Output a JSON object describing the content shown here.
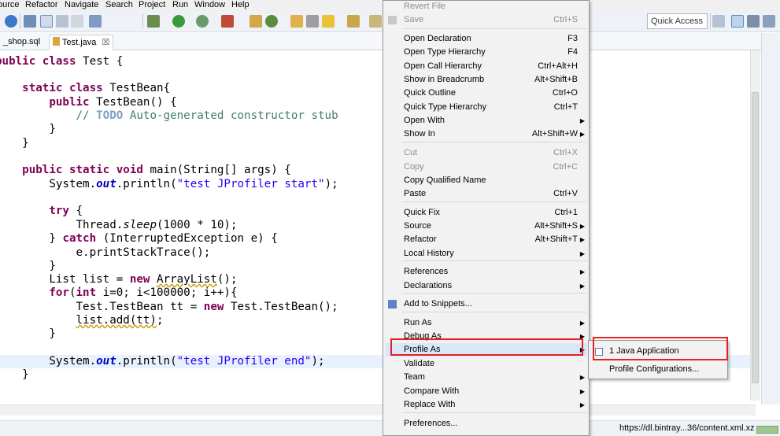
{
  "menubar": {
    "items": [
      "ource",
      "Refactor",
      "Navigate",
      "Search",
      "Project",
      "Run",
      "Window",
      "Help"
    ]
  },
  "toolbar": {
    "quick_access_placeholder": "Quick Access",
    "icons": [
      "help-icon",
      "new-icon",
      "select-icon",
      "cursor-icon",
      "text-icon",
      "debug-icon",
      "run-icon",
      "stop-icon",
      "profile-icon",
      "build-icon",
      "search-icon",
      "back-icon",
      "forward-icon",
      "perspective-icon"
    ]
  },
  "tabs": [
    {
      "label": "_shop.sql"
    },
    {
      "label": "Test.java",
      "close": "☒"
    }
  ],
  "editor": {
    "lines": [
      {
        "indent": "",
        "tokens": [
          {
            "t": "public class",
            "c": "kw"
          },
          {
            "t": " Test {"
          }
        ]
      },
      {
        "indent": "",
        "tokens": []
      },
      {
        "indent": "    ",
        "tokens": [
          {
            "t": "static class",
            "c": "kw"
          },
          {
            "t": " TestBean{"
          }
        ]
      },
      {
        "indent": "        ",
        "tokens": [
          {
            "t": "public",
            "c": "kw"
          },
          {
            "t": " TestBean() {"
          }
        ]
      },
      {
        "indent": "            ",
        "tokens": [
          {
            "t": "// ",
            "c": "cm"
          },
          {
            "t": "TODO",
            "c": "todo"
          },
          {
            "t": " Auto-generated constructor stub",
            "c": "cm"
          }
        ]
      },
      {
        "indent": "        ",
        "tokens": [
          {
            "t": "}"
          }
        ]
      },
      {
        "indent": "    ",
        "tokens": [
          {
            "t": "}"
          }
        ]
      },
      {
        "indent": "",
        "tokens": []
      },
      {
        "indent": "    ",
        "tokens": [
          {
            "t": "public static void",
            "c": "kw"
          },
          {
            "t": " main(String[] args) {"
          }
        ]
      },
      {
        "indent": "        ",
        "tokens": [
          {
            "t": "System."
          },
          {
            "t": "out",
            "c": "fld"
          },
          {
            "t": ".println("
          },
          {
            "t": "\"test JProfiler start\"",
            "c": "str"
          },
          {
            "t": ");"
          }
        ]
      },
      {
        "indent": "",
        "tokens": []
      },
      {
        "indent": "        ",
        "tokens": [
          {
            "t": "try",
            "c": "kw"
          },
          {
            "t": " {"
          }
        ]
      },
      {
        "indent": "            ",
        "tokens": [
          {
            "t": "Thread."
          },
          {
            "t": "sleep",
            "c": "ital"
          },
          {
            "t": "(1000 * 10);"
          }
        ]
      },
      {
        "indent": "        ",
        "tokens": [
          {
            "t": "} "
          },
          {
            "t": "catch",
            "c": "kw"
          },
          {
            "t": " (InterruptedException e) {"
          }
        ]
      },
      {
        "indent": "            ",
        "tokens": [
          {
            "t": "e.printStackTrace();"
          }
        ]
      },
      {
        "indent": "        ",
        "tokens": [
          {
            "t": "}"
          }
        ]
      },
      {
        "indent": "        ",
        "tokens": [
          {
            "t": "List list = "
          },
          {
            "t": "new",
            "c": "kw"
          },
          {
            "t": " "
          },
          {
            "t": "ArrayList",
            "c": "warn"
          },
          {
            "t": "();"
          }
        ]
      },
      {
        "indent": "        ",
        "tokens": [
          {
            "t": "for",
            "c": "kw"
          },
          {
            "t": "("
          },
          {
            "t": "int",
            "c": "kw"
          },
          {
            "t": " i=0; i<100000; i++){"
          }
        ]
      },
      {
        "indent": "            ",
        "tokens": [
          {
            "t": "Test.TestBean tt = "
          },
          {
            "t": "new",
            "c": "kw"
          },
          {
            "t": " Test.TestBean();"
          }
        ]
      },
      {
        "indent": "            ",
        "tokens": [
          {
            "t": "list.add(tt)",
            "c": "warn"
          },
          {
            "t": ";"
          }
        ]
      },
      {
        "indent": "        ",
        "tokens": [
          {
            "t": "}"
          }
        ]
      },
      {
        "indent": "",
        "tokens": []
      },
      {
        "indent": "        ",
        "tokens": [
          {
            "t": "System."
          },
          {
            "t": "out",
            "c": "fld"
          },
          {
            "t": ".println("
          },
          {
            "t": "\"test JProfiler end\"",
            "c": "str"
          },
          {
            "t": ");"
          }
        ]
      },
      {
        "indent": "    ",
        "tokens": [
          {
            "t": "}"
          }
        ]
      }
    ]
  },
  "context_menu": {
    "items": [
      {
        "label": "Revert File",
        "shortcut": "",
        "disabled": true,
        "submenu": false
      },
      {
        "label": "Save",
        "shortcut": "Ctrl+S",
        "disabled": true,
        "submenu": false,
        "icon": "save-icon"
      },
      {
        "sep": true
      },
      {
        "label": "Open Declaration",
        "shortcut": "F3"
      },
      {
        "label": "Open Type Hierarchy",
        "shortcut": "F4"
      },
      {
        "label": "Open Call Hierarchy",
        "shortcut": "Ctrl+Alt+H"
      },
      {
        "label": "Show in Breadcrumb",
        "shortcut": "Alt+Shift+B"
      },
      {
        "label": "Quick Outline",
        "shortcut": "Ctrl+O"
      },
      {
        "label": "Quick Type Hierarchy",
        "shortcut": "Ctrl+T"
      },
      {
        "label": "Open With",
        "shortcut": "",
        "submenu": true
      },
      {
        "label": "Show In",
        "shortcut": "Alt+Shift+W",
        "submenu": true
      },
      {
        "sep": true
      },
      {
        "label": "Cut",
        "shortcut": "Ctrl+X",
        "disabled": true
      },
      {
        "label": "Copy",
        "shortcut": "Ctrl+C",
        "disabled": true
      },
      {
        "label": "Copy Qualified Name",
        "shortcut": ""
      },
      {
        "label": "Paste",
        "shortcut": "Ctrl+V"
      },
      {
        "sep": true
      },
      {
        "label": "Quick Fix",
        "shortcut": "Ctrl+1"
      },
      {
        "label": "Source",
        "shortcut": "Alt+Shift+S",
        "submenu": true
      },
      {
        "label": "Refactor",
        "shortcut": "Alt+Shift+T",
        "submenu": true
      },
      {
        "label": "Local History",
        "shortcut": "",
        "submenu": true
      },
      {
        "sep": true
      },
      {
        "label": "References",
        "shortcut": "",
        "submenu": true
      },
      {
        "label": "Declarations",
        "shortcut": "",
        "submenu": true
      },
      {
        "sep": true
      },
      {
        "label": "Add to Snippets...",
        "shortcut": "",
        "icon": "snippet-icon"
      },
      {
        "sep": true
      },
      {
        "label": "Run As",
        "shortcut": "",
        "submenu": true
      },
      {
        "label": "Debug As",
        "shortcut": "",
        "submenu": true
      },
      {
        "label": "Profile As",
        "shortcut": "",
        "submenu": true,
        "hovered": true
      },
      {
        "label": "Validate",
        "shortcut": ""
      },
      {
        "label": "Team",
        "shortcut": "",
        "submenu": true
      },
      {
        "label": "Compare With",
        "shortcut": "",
        "submenu": true
      },
      {
        "label": "Replace With",
        "shortcut": "",
        "submenu": true
      },
      {
        "sep": true
      },
      {
        "label": "Preferences...",
        "shortcut": ""
      }
    ]
  },
  "submenu": {
    "items": [
      {
        "label": "1 Java Application",
        "icon": "java-app-icon"
      },
      {
        "label": "Profile Configurations..."
      }
    ]
  },
  "statusbar": {
    "url": "https://dl.bintray...36/content.xml.xz"
  },
  "colors": {
    "highlight": "#e82020",
    "keyword": "#7f0055",
    "comment": "#3f7f5f",
    "string": "#2a00ff"
  }
}
